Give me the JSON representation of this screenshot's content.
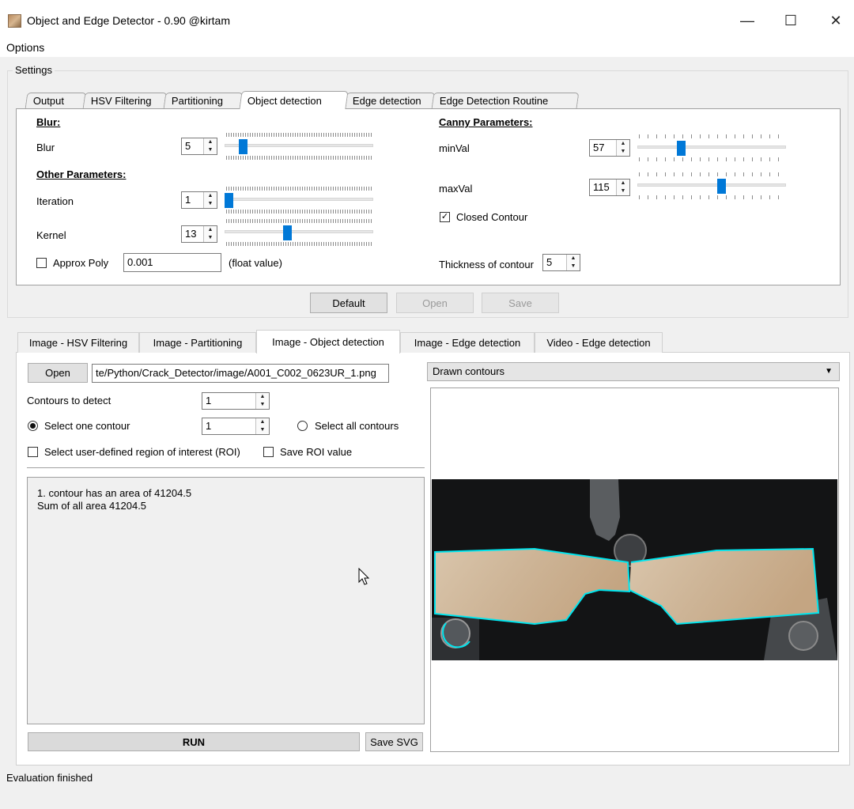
{
  "window": {
    "title": "Object and Edge Detector - 0.90 @kirtam",
    "minimize_glyph": "—",
    "maximize_glyph": "☐",
    "close_glyph": "✕"
  },
  "menu": {
    "options_label": "Options"
  },
  "settings": {
    "group_label": "Settings",
    "tabs": [
      {
        "label": "Output"
      },
      {
        "label": "HSV Filtering"
      },
      {
        "label": "Partitioning"
      },
      {
        "label": "Object detection"
      },
      {
        "label": "Edge detection"
      },
      {
        "label": "Edge Detection Routine"
      }
    ],
    "active_tab": "Object detection",
    "blur": {
      "header": "Blur:",
      "label": "Blur",
      "value": "5",
      "slider_fraction": 0.1
    },
    "other": {
      "header": "Other Parameters:",
      "iteration_label": "Iteration",
      "iteration_value": "1",
      "iteration_fraction": 0.0,
      "kernel_label": "Kernel",
      "kernel_value": "13",
      "kernel_fraction": 0.42
    },
    "approx": {
      "checkbox_label": "Approx Poly",
      "checked": false,
      "value": "0.001",
      "hint": "(float value)"
    },
    "canny": {
      "header": "Canny Parameters:",
      "minval_label": "minVal",
      "minval_value": "57",
      "minval_fraction": 0.28,
      "maxval_label": "maxVal",
      "maxval_value": "115",
      "maxval_fraction": 0.57,
      "closed_label": "Closed Contour",
      "closed_checked": true
    },
    "thickness": {
      "label": "Thickness of contour",
      "value": "5"
    },
    "buttons": {
      "default": "Default",
      "open": "Open",
      "save": "Save"
    }
  },
  "image_tabs": [
    {
      "label": "Image - HSV Filtering"
    },
    {
      "label": "Image - Partitioning"
    },
    {
      "label": "Image - Object detection"
    },
    {
      "label": "Image - Edge detection"
    },
    {
      "label": "Video - Edge detection"
    }
  ],
  "active_image_tab": "Image - Object detection",
  "object_detection": {
    "open_label": "Open",
    "file_path": "te/Python/Crack_Detector/image/A001_C002_0623UR_1.png",
    "contours_label": "Contours to detect",
    "contours_value": "1",
    "select_one_label": "Select one contour",
    "select_one_value": "1",
    "select_all_label": "Select all contours",
    "roi_label": "Select user-defined region of interest (ROI)",
    "save_roi_label": "Save ROI value",
    "log_lines": [
      "1. contour has an area of 41204.5",
      "Sum of all area 41204.5"
    ],
    "run_label": "RUN",
    "save_svg_label": "Save SVG",
    "display_option": "Drawn contours",
    "dropdown_arrow": "▼"
  },
  "status": "Evaluation finished",
  "colors": {
    "accent": "#0078d7",
    "contour": "#00e5ee"
  }
}
